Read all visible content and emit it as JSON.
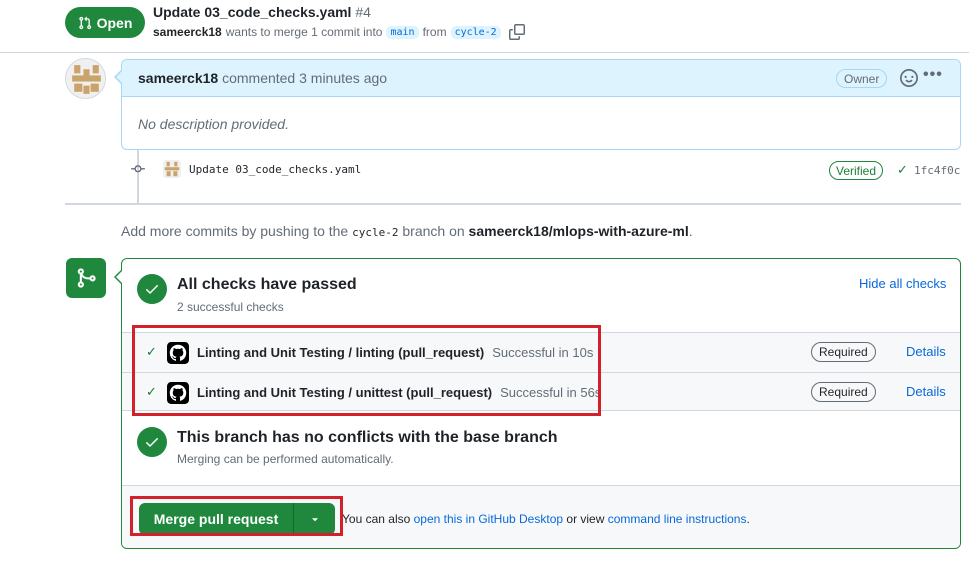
{
  "header": {
    "state": "Open",
    "title": "Update 03_code_checks.yaml",
    "number": "#4",
    "author": "sameerck18",
    "merge_text": "wants to merge 1 commit into",
    "base_branch": "main",
    "from_text": "from",
    "head_branch": "cycle-2"
  },
  "comment": {
    "author": "sameerck18",
    "action": "commented 3 minutes ago",
    "role": "Owner",
    "body": "No description provided."
  },
  "commit": {
    "message": "Update 03_code_checks.yaml",
    "verified": "Verified",
    "sha": "1fc4f0c"
  },
  "push_info": {
    "prefix": "Add more commits by pushing to the",
    "branch": "cycle-2",
    "middle": "branch on",
    "repo": "sameerck18/mlops-with-azure-ml",
    "suffix": "."
  },
  "checks": {
    "title": "All checks have passed",
    "subtitle": "2 successful checks",
    "toggle": "Hide all checks",
    "items": [
      {
        "name": "Linting and Unit Testing / linting (pull_request)",
        "status": "Successful in 10s",
        "badge": "Required",
        "link": "Details"
      },
      {
        "name": "Linting and Unit Testing / unittest (pull_request)",
        "status": "Successful in 56s",
        "badge": "Required",
        "link": "Details"
      }
    ]
  },
  "conflicts": {
    "title": "This branch has no conflicts with the base branch",
    "subtitle": "Merging can be performed automatically."
  },
  "merge": {
    "button": "Merge pull request",
    "alt_prefix": "You can also",
    "desktop_link": "open this in GitHub Desktop",
    "alt_middle": "or view",
    "cli_link": "command line instructions",
    "alt_suffix": "."
  },
  "colors": {
    "accent_green": "#1f883d",
    "link_blue": "#0969da",
    "highlight_red": "#d4202a",
    "comment_header": "#ddf4ff"
  }
}
